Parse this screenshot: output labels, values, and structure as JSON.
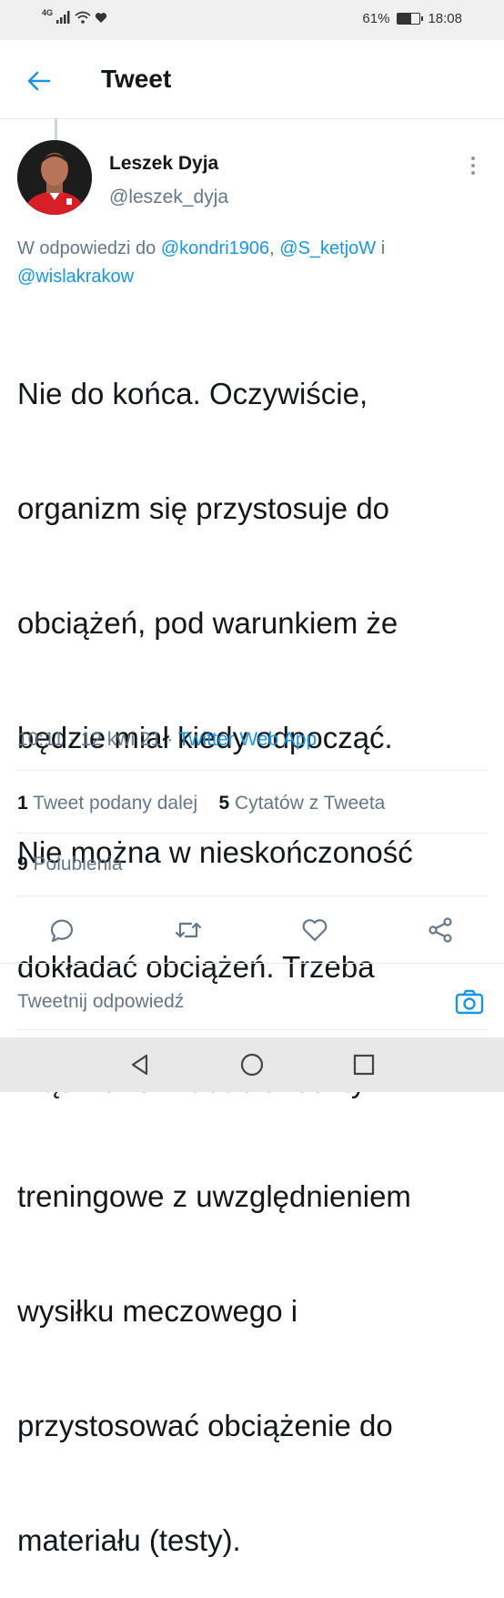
{
  "status_bar": {
    "network": "4G",
    "battery_percent": "61%",
    "battery_level": 0.61,
    "time": "18:08"
  },
  "header": {
    "title": "Tweet"
  },
  "tweet": {
    "author_name": "Leszek Dyja",
    "author_handle": "@leszek_dyja",
    "reply_prefix": "W odpowiedzi do ",
    "mention_1": "@kondri1906",
    "separator": ", ",
    "mention_2": "@S_ketjoW",
    "conjunction": " i ",
    "mention_3": "@wislakrakow",
    "text_lines": [
      "Nie do końca. Oczywiście,",
      "organizm się przystosuje do",
      "obciążeń, pod warunkiem że",
      "będzie miał kiedy odpocząć.",
      "Nie można w nieskończoność",
      "dokładać obciążeń. Trzeba",
      "mądrze rozkładać akcenty",
      "treningowe z uwzględnieniem",
      "wysiłku meczowego i",
      "przystosować obciążenie do",
      "materiału (testy)."
    ],
    "time": "10:11",
    "dot": " · ",
    "date": "12 kwi 21",
    "source": "Twitter Web App"
  },
  "stats": {
    "retweets_count": "1",
    "retweets_label": "Tweet podany dalej",
    "quotes_count": "5",
    "quotes_label": "Cytatów z Tweeta",
    "likes_count": "9",
    "likes_label": "Polubienia"
  },
  "reply": {
    "placeholder": "Tweetnij odpowiedź"
  },
  "colors": {
    "accent": "#1b95e0",
    "secondary_text": "#657786",
    "divider": "#e6ecf0"
  }
}
